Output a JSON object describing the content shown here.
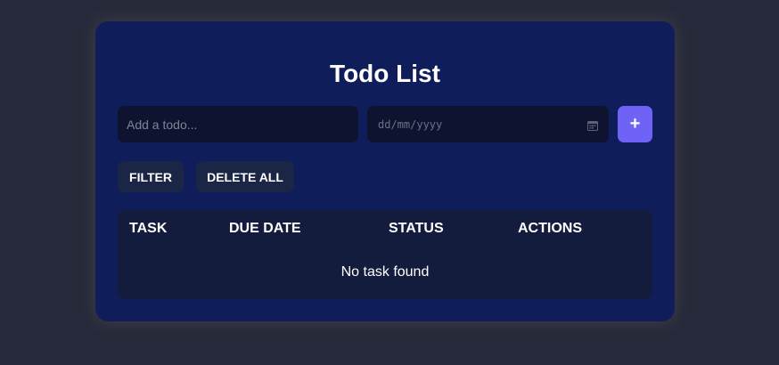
{
  "app": {
    "title": "Todo List"
  },
  "form": {
    "todo_placeholder": "Add a todo...",
    "todo_value": "",
    "date_placeholder": "dd/mm/yyyy",
    "add_label": "+"
  },
  "toolbar": {
    "filter_label": "FILTER",
    "delete_all_label": "DELETE ALL"
  },
  "table": {
    "columns": [
      "TASK",
      "DUE DATE",
      "STATUS",
      "ACTIONS"
    ],
    "rows": [],
    "empty_message": "No task found"
  },
  "icons": {
    "date": "calendar-icon",
    "add": "plus-icon"
  },
  "colors": {
    "background": "#262a3a",
    "card": "#0f1d5a",
    "input": "#0e1430",
    "accent": "#6e63f5",
    "button": "#1b2546",
    "table": "#131c3c"
  }
}
